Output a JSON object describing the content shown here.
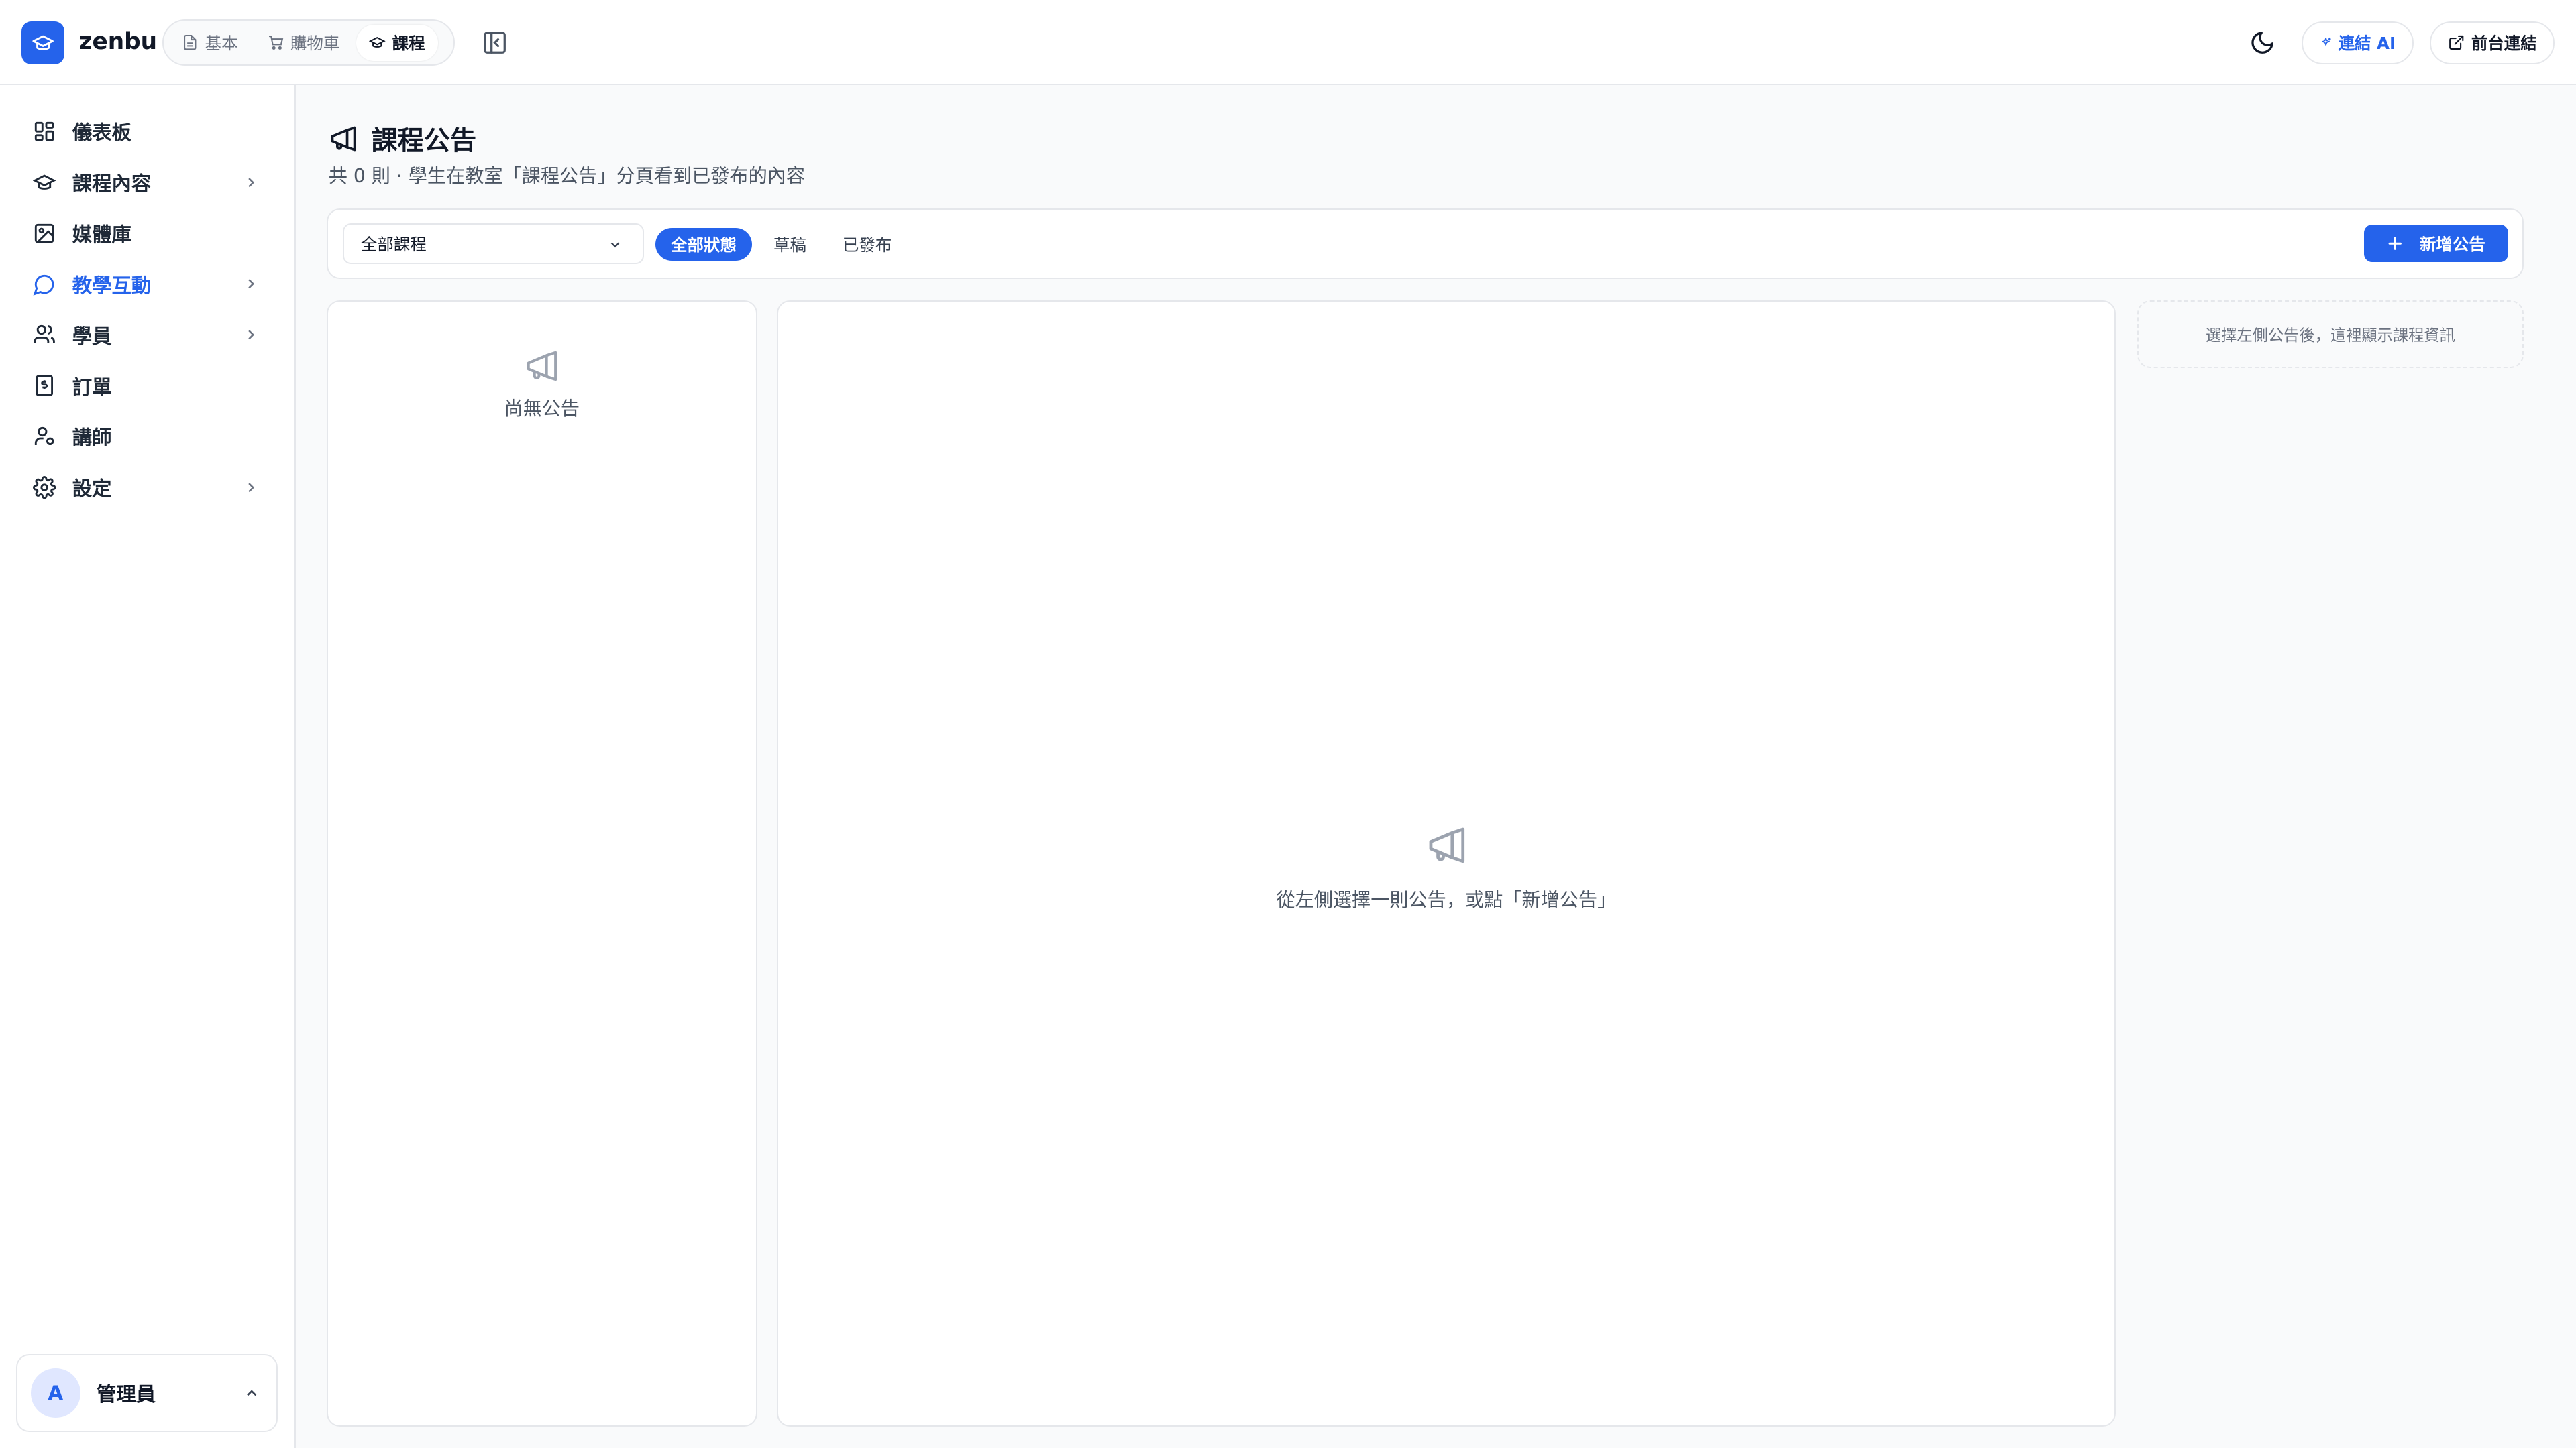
{
  "app": {
    "brand": "zenbu"
  },
  "header": {
    "tabs": [
      {
        "label": "基本",
        "icon": "document-icon"
      },
      {
        "label": "購物車",
        "icon": "cart-icon"
      },
      {
        "label": "課程",
        "icon": "graduation-cap-icon",
        "active": true
      }
    ],
    "ai_button": "連結 AI",
    "front_button": "前台連結"
  },
  "sidebar": {
    "items": [
      {
        "label": "儀表板",
        "icon": "dashboard-icon"
      },
      {
        "label": "課程內容",
        "icon": "graduation-cap-icon",
        "has_children": true
      },
      {
        "label": "媒體庫",
        "icon": "image-icon"
      },
      {
        "label": "教學互動",
        "icon": "chat-icon",
        "has_children": true,
        "active": true
      },
      {
        "label": "學員",
        "icon": "users-icon",
        "has_children": true
      },
      {
        "label": "訂單",
        "icon": "receipt-icon"
      },
      {
        "label": "講師",
        "icon": "user-icon"
      },
      {
        "label": "設定",
        "icon": "gear-icon",
        "has_children": true
      }
    ],
    "user": {
      "initial": "A",
      "name": "管理員"
    }
  },
  "main": {
    "title": "課程公告",
    "subtitle": "共 0 則 · 學生在教室「課程公告」分頁看到已發布的內容",
    "filter": {
      "course_select": "全部課程",
      "status_tabs": [
        "全部狀態",
        "草稿",
        "已發布"
      ],
      "active_status": "全部狀態",
      "new_button": "新增公告"
    },
    "list_empty": "尚無公告",
    "detail_empty": "從左側選擇一則公告，或點「新增公告」",
    "info_hint": "選擇左側公告後，這裡顯示課程資訊"
  },
  "colors": {
    "accent": "#2563eb",
    "border": "#e5e7eb",
    "background": "#f9fafb"
  }
}
